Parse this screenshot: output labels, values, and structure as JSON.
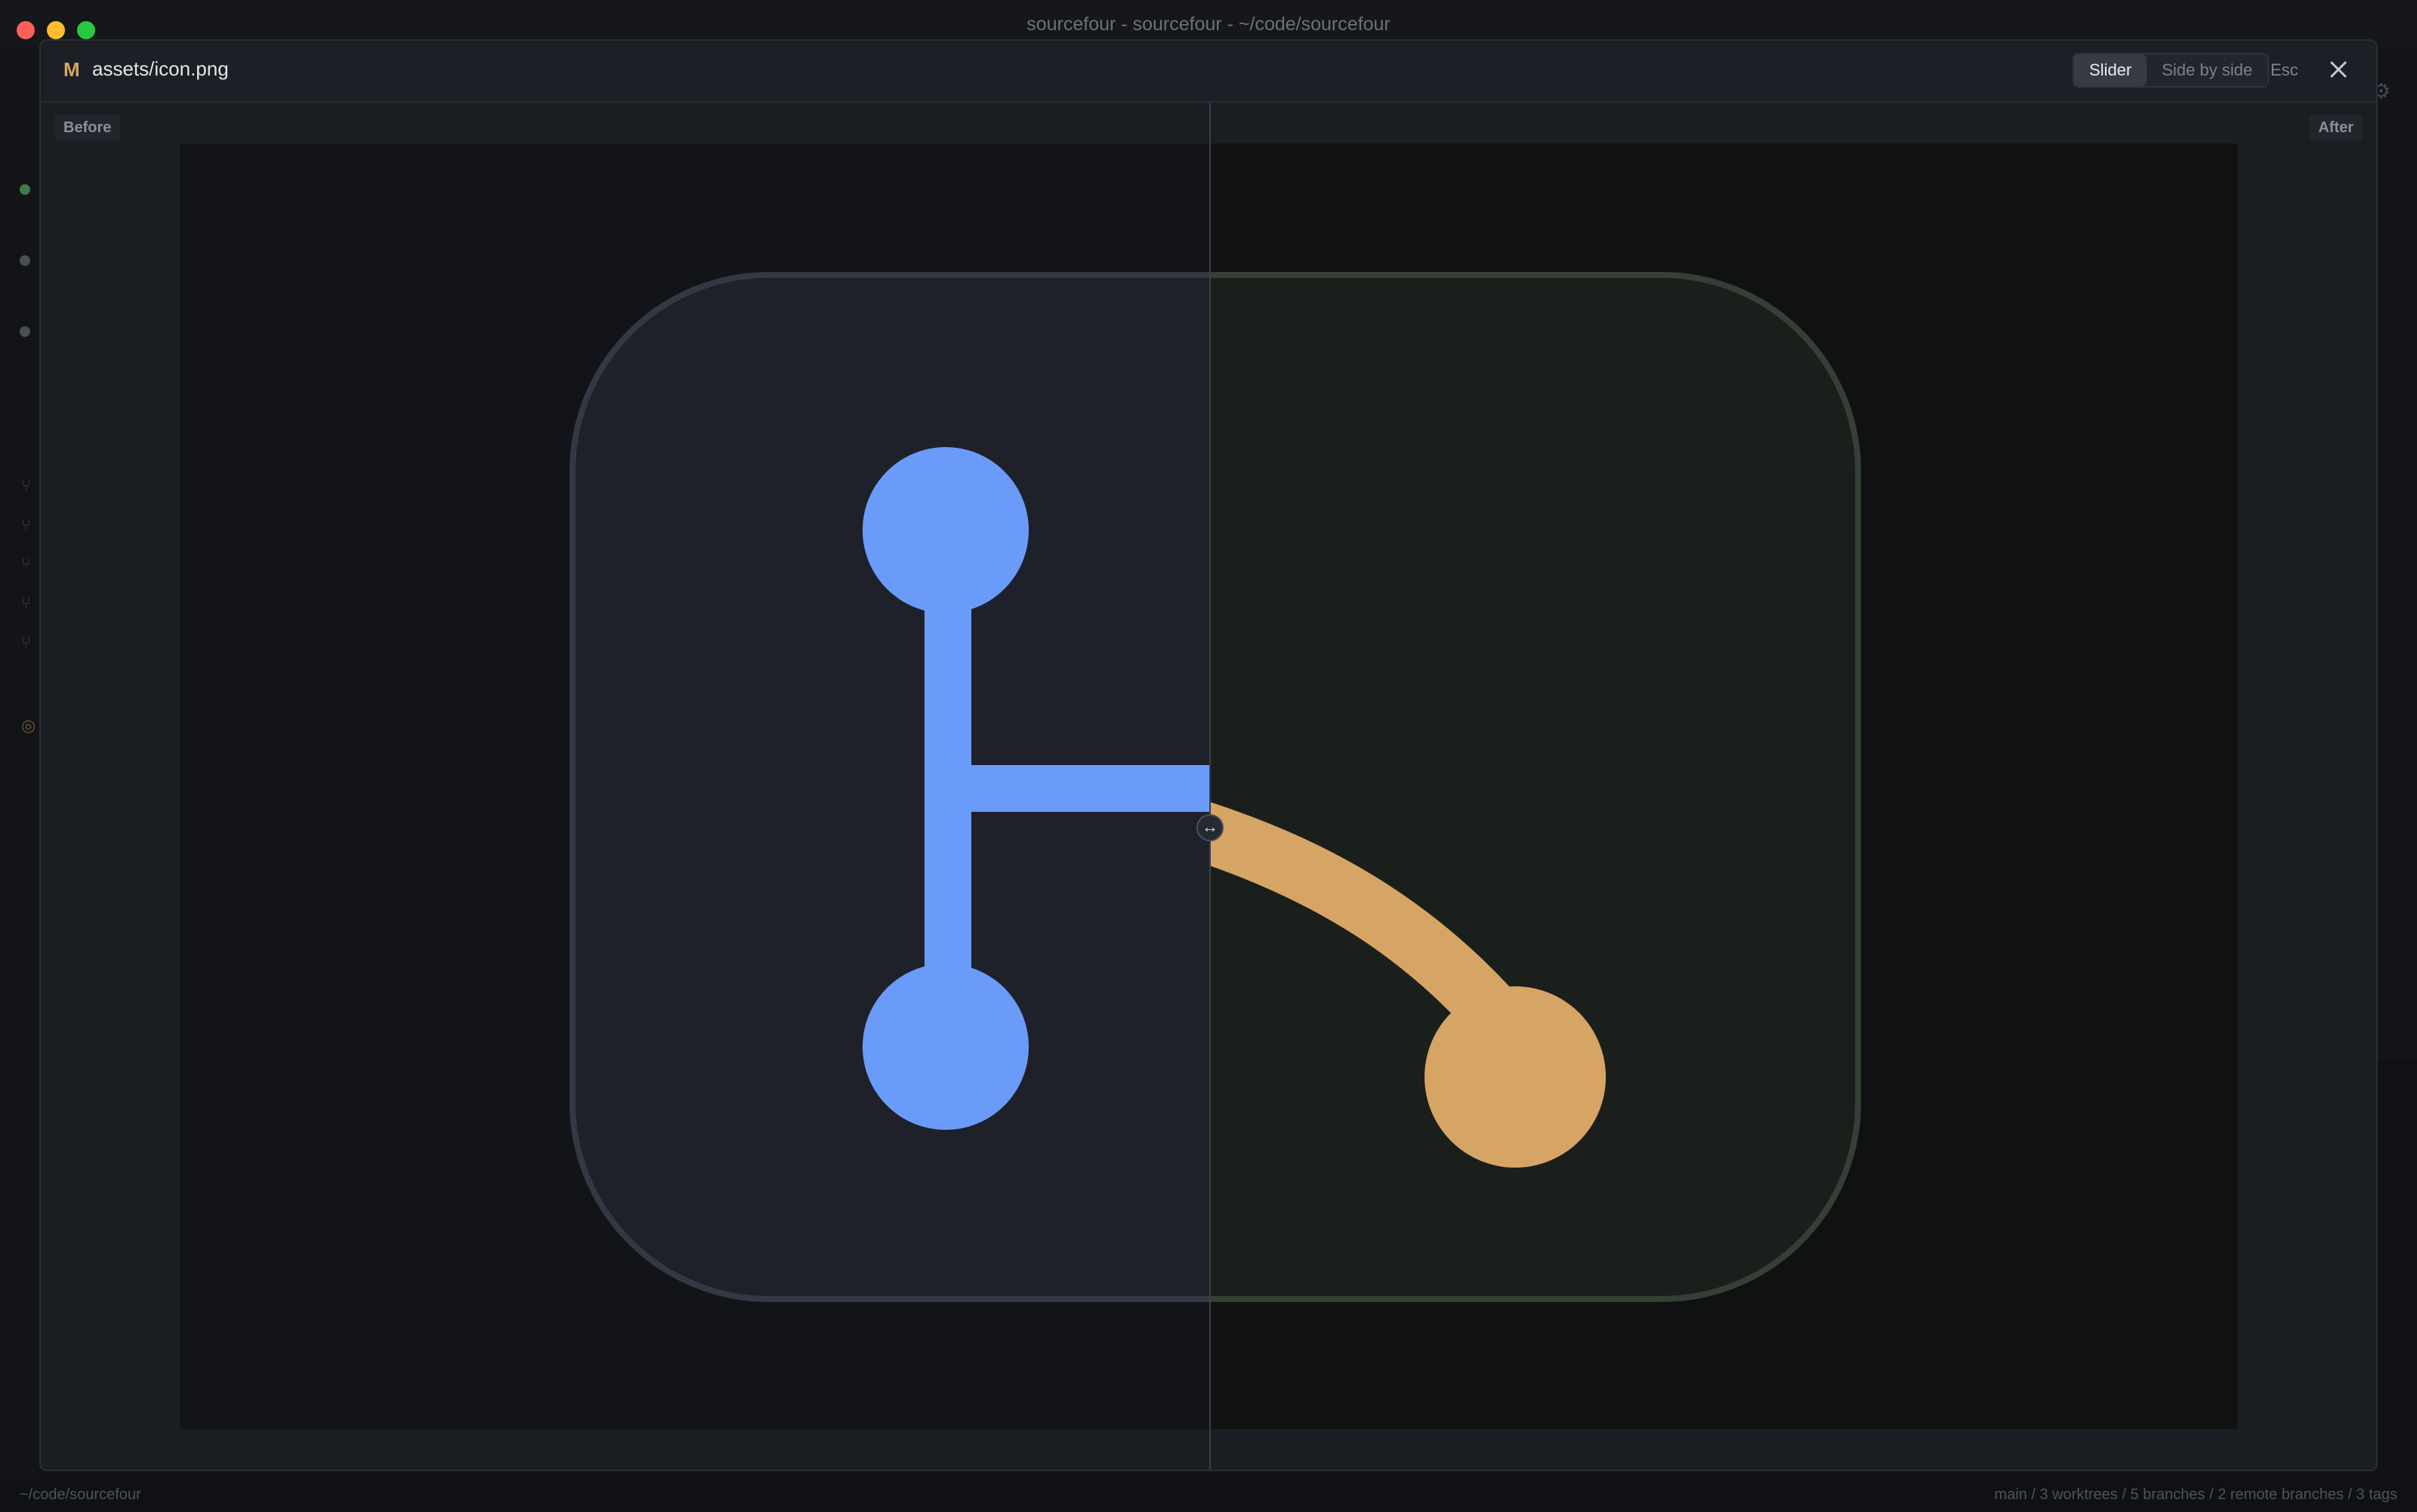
{
  "window": {
    "title": "sourcefour - sourcefour - ~/code/sourcefour"
  },
  "modal": {
    "status_letter": "M",
    "file_path": "assets/icon.png",
    "view_modes": [
      {
        "label": "Slider",
        "active": true
      },
      {
        "label": "Side by side",
        "active": false
      }
    ],
    "esc_hint": "Esc",
    "before_label": "Before",
    "after_label": "After",
    "slider_handle_glyph": "↔",
    "slider_position": 0.5
  },
  "statusbar": {
    "path": "~/code/sourcefour",
    "summary": "main / 3 worktrees / 5 branches / 2 remote branches / 3 tags"
  },
  "colors": {
    "before_branch": "#6b9bf8",
    "after_branch": "#d6a565",
    "status_modified": "#d4a565"
  },
  "icons": {
    "close": "close-icon",
    "handle": "drag-horizontal-icon",
    "settings": "gear-icon"
  }
}
